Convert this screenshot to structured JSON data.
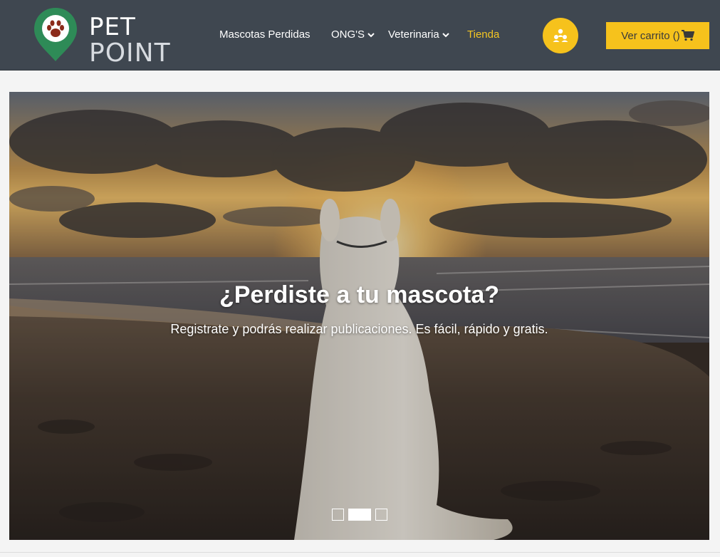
{
  "brand": {
    "line1": "PET",
    "line2": "POINT"
  },
  "nav": {
    "lost_pets": "Mascotas Perdidas",
    "ngos": "ONG'S",
    "vet": "Veterinaria",
    "shop": "Tienda"
  },
  "user_icon": "users-icon",
  "cart": {
    "label": "Ver carrito ()",
    "icon": "shopping-cart-icon"
  },
  "carousel": {
    "title": "¿Perdiste a tu mascota?",
    "subtitle": "Registrate y podrás realizar publicaciones. Es fácil, rápido y gratis.",
    "slide_count": 3,
    "active_slide": 2
  },
  "colors": {
    "navbar": "#3f4750",
    "accent": "#f6c21c",
    "logo_green": "#2e8b57",
    "shop_link": "#f4c623"
  }
}
